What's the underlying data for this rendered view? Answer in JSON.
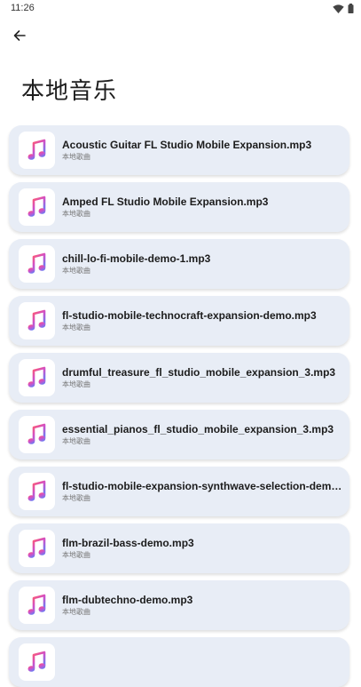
{
  "status_bar": {
    "time": "11:26"
  },
  "header": {
    "title": "本地音乐"
  },
  "songs": [
    {
      "title": "Acoustic Guitar FL Studio Mobile Expansion.mp3",
      "subtitle": "本地歌曲"
    },
    {
      "title": "Amped FL Studio Mobile Expansion.mp3",
      "subtitle": "本地歌曲"
    },
    {
      "title": "chill-lo-fi-mobile-demo-1.mp3",
      "subtitle": "本地歌曲"
    },
    {
      "title": "fl-studio-mobile-technocraft-expansion-demo.mp3",
      "subtitle": "本地歌曲"
    },
    {
      "title": "drumful_treasure_fl_studio_mobile_expansion_3.mp3",
      "subtitle": "本地歌曲"
    },
    {
      "title": "essential_pianos_fl_studio_mobile_expansion_3.mp3",
      "subtitle": "本地歌曲"
    },
    {
      "title": "fl-studio-mobile-expansion-synthwave-selection-demo...",
      "subtitle": "本地歌曲"
    },
    {
      "title": "flm-brazil-bass-demo.mp3",
      "subtitle": "本地歌曲"
    },
    {
      "title": "flm-dubtechno-demo.mp3",
      "subtitle": "本地歌曲"
    },
    {
      "title": "",
      "subtitle": ""
    }
  ]
}
